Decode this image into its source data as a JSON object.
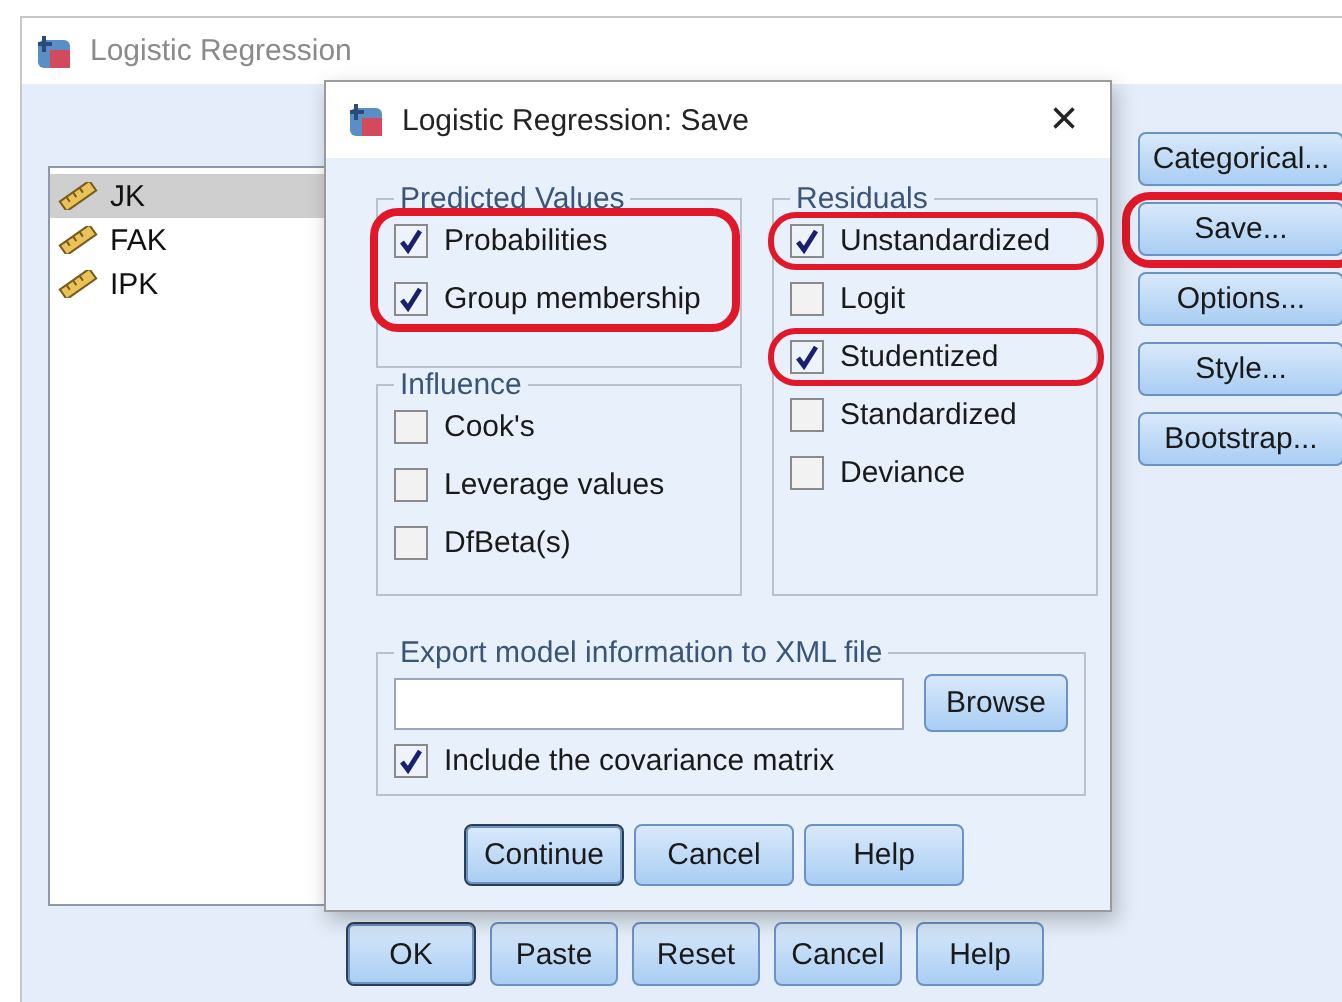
{
  "main_window": {
    "title": "Logistic Regression",
    "variables": [
      {
        "name": "JK",
        "selected": true
      },
      {
        "name": "FAK",
        "selected": false
      },
      {
        "name": "IPK",
        "selected": false
      }
    ],
    "side_buttons": [
      {
        "label": "Categorical...",
        "highlighted": false
      },
      {
        "label": "Save...",
        "highlighted": true
      },
      {
        "label": "Options...",
        "highlighted": false
      },
      {
        "label": "Style...",
        "highlighted": false
      },
      {
        "label": "Bootstrap...",
        "highlighted": false
      }
    ],
    "buttons": [
      {
        "label": "OK",
        "default": true
      },
      {
        "label": "Paste",
        "default": false
      },
      {
        "label": "Reset",
        "default": false
      },
      {
        "label": "Cancel",
        "default": false
      },
      {
        "label": "Help",
        "default": false
      }
    ]
  },
  "dialog": {
    "title": "Logistic Regression: Save",
    "close": "×",
    "predicted_values": {
      "title": "Predicted Values",
      "highlighted": true,
      "options": [
        {
          "label": "Probabilities",
          "checked": true
        },
        {
          "label": "Group membership",
          "checked": true
        }
      ]
    },
    "influence": {
      "title": "Influence",
      "options": [
        {
          "label": "Cook's",
          "checked": false
        },
        {
          "label": "Leverage values",
          "checked": false
        },
        {
          "label": "DfBeta(s)",
          "checked": false
        }
      ]
    },
    "residuals": {
      "title": "Residuals",
      "options": [
        {
          "label": "Unstandardized",
          "checked": true,
          "highlighted": true
        },
        {
          "label": "Logit",
          "checked": false,
          "highlighted": false
        },
        {
          "label": "Studentized",
          "checked": true,
          "highlighted": true
        },
        {
          "label": "Standardized",
          "checked": false,
          "highlighted": false
        },
        {
          "label": "Deviance",
          "checked": false,
          "highlighted": false
        }
      ]
    },
    "export": {
      "title": "Export model information to XML file",
      "browse": "Browse",
      "include_covariance": {
        "label": "Include the covariance matrix",
        "checked": true
      }
    },
    "buttons": [
      {
        "label": "Continue",
        "default": true
      },
      {
        "label": "Cancel",
        "default": false
      },
      {
        "label": "Help",
        "default": false
      }
    ]
  }
}
